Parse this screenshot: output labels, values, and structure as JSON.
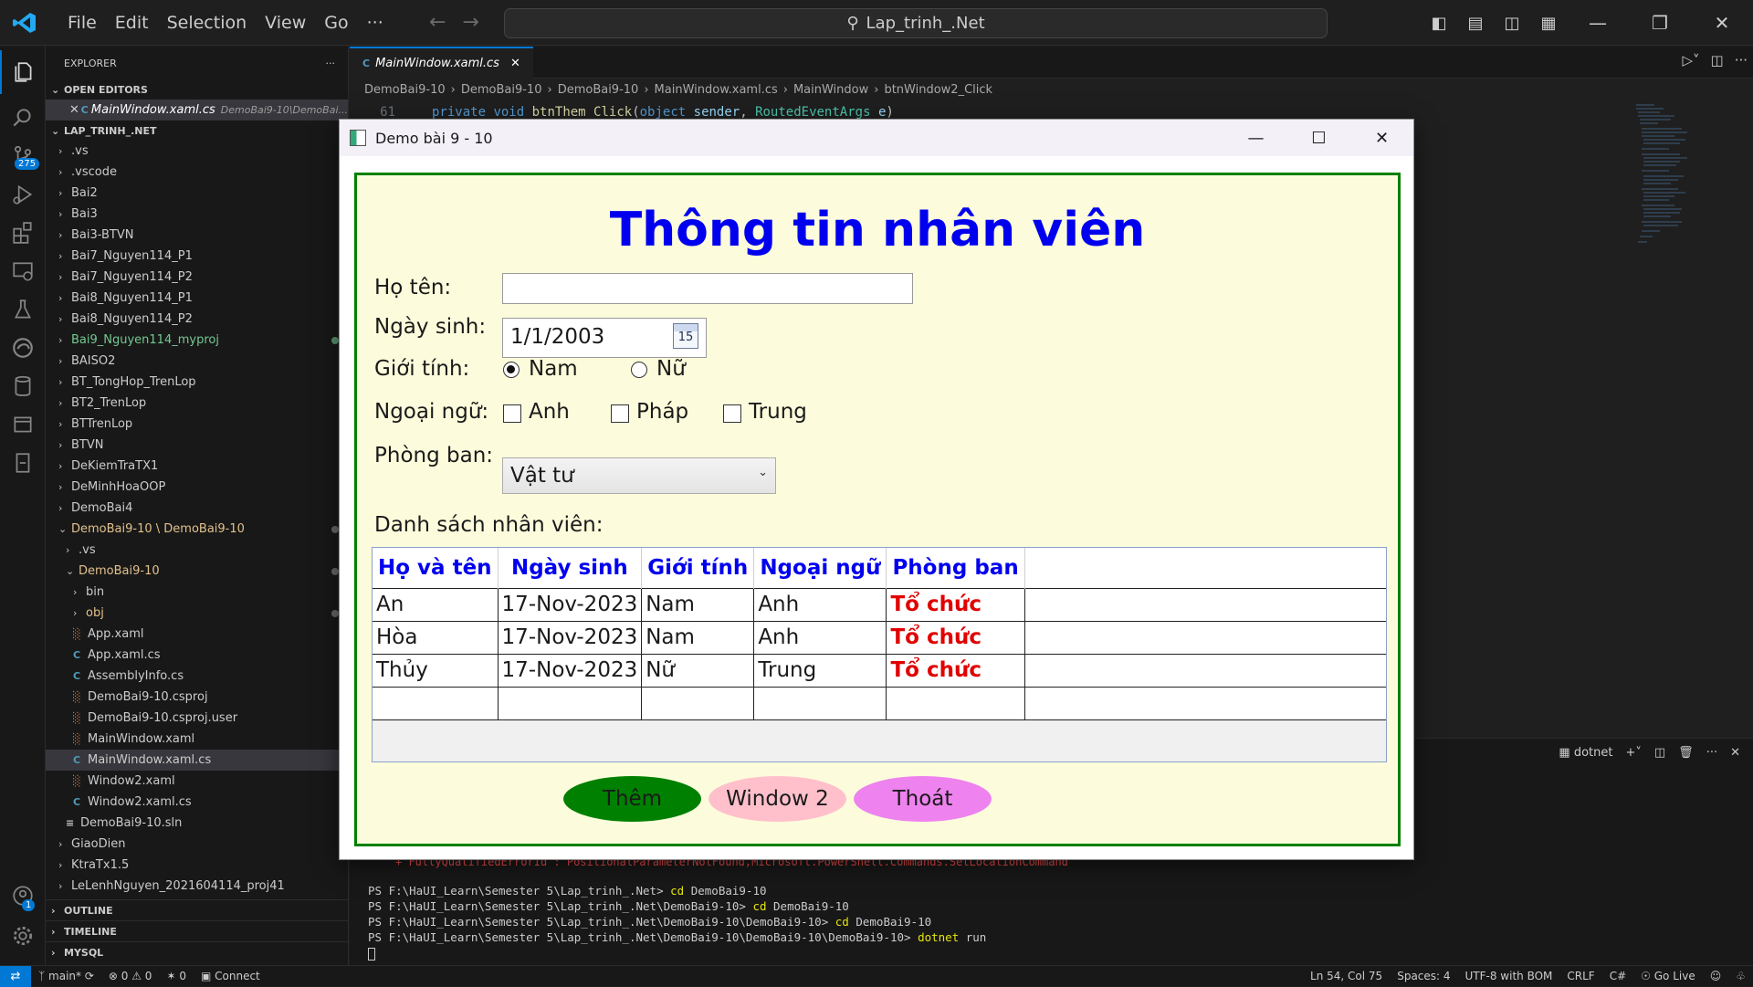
{
  "vscode": {
    "menu": [
      "File",
      "Edit",
      "Selection",
      "View",
      "Go",
      "···"
    ],
    "search_text": "Lap_trinh_.Net",
    "scm_badge": "275",
    "account_badge": "1",
    "explorer_title": "EXPLORER",
    "open_editors_label": "OPEN EDITORS",
    "open_editor_file": "MainWindow.xaml.cs",
    "open_editor_path": "DemoBai9-10\\DemoBai...",
    "root_label": "LAP_TRINH_.NET",
    "tree": [
      {
        "label": ".vs",
        "kind": "folder",
        "depth": 1
      },
      {
        "label": ".vscode",
        "kind": "folder",
        "depth": 1
      },
      {
        "label": "Bai2",
        "kind": "folder",
        "depth": 1
      },
      {
        "label": "Bai3",
        "kind": "folder",
        "depth": 1
      },
      {
        "label": "Bai3-BTVN",
        "kind": "folder",
        "depth": 1
      },
      {
        "label": "Bai7_Nguyen114_P1",
        "kind": "folder",
        "depth": 1
      },
      {
        "label": "Bai7_Nguyen114_P2",
        "kind": "folder",
        "depth": 1
      },
      {
        "label": "Bai8_Nguyen114_P1",
        "kind": "folder",
        "depth": 1
      },
      {
        "label": "Bai8_Nguyen114_P2",
        "kind": "folder",
        "depth": 1
      },
      {
        "label": "Bai9_Nguyen114_myproj",
        "kind": "folder",
        "depth": 1,
        "color": "green",
        "dot": "green"
      },
      {
        "label": "BAISO2",
        "kind": "folder",
        "depth": 1
      },
      {
        "label": "BT_TongHop_TrenLop",
        "kind": "folder",
        "depth": 1
      },
      {
        "label": "BT2_TrenLop",
        "kind": "folder",
        "depth": 1
      },
      {
        "label": "BTTrenLop",
        "kind": "folder",
        "depth": 1
      },
      {
        "label": "BTVN",
        "kind": "folder",
        "depth": 1
      },
      {
        "label": "DeKiemTraTX1",
        "kind": "folder",
        "depth": 1
      },
      {
        "label": "DeMinhHoaOOP",
        "kind": "folder",
        "depth": 1
      },
      {
        "label": "DemoBai4",
        "kind": "folder",
        "depth": 1
      },
      {
        "label": "DemoBai9-10 \\ DemoBai9-10",
        "kind": "open",
        "depth": 1,
        "color": "yellow",
        "dot": "grey"
      },
      {
        "label": ".vs",
        "kind": "folder",
        "depth": 2
      },
      {
        "label": "DemoBai9-10",
        "kind": "open",
        "depth": 2,
        "color": "yellow",
        "dot": "grey"
      },
      {
        "label": "bin",
        "kind": "folder",
        "depth": 3
      },
      {
        "label": "obj",
        "kind": "folder",
        "depth": 3,
        "color": "yellow",
        "dot": "grey"
      },
      {
        "label": "App.xaml",
        "kind": "xaml",
        "depth": 3
      },
      {
        "label": "App.xaml.cs",
        "kind": "cs",
        "depth": 3
      },
      {
        "label": "AssemblyInfo.cs",
        "kind": "cs",
        "depth": 3
      },
      {
        "label": "DemoBai9-10.csproj",
        "kind": "xaml",
        "depth": 3
      },
      {
        "label": "DemoBai9-10.csproj.user",
        "kind": "xaml",
        "depth": 3
      },
      {
        "label": "MainWindow.xaml",
        "kind": "xaml",
        "depth": 3
      },
      {
        "label": "MainWindow.xaml.cs",
        "kind": "cs",
        "depth": 3,
        "selected": true
      },
      {
        "label": "Window2.xaml",
        "kind": "xaml",
        "depth": 3
      },
      {
        "label": "Window2.xaml.cs",
        "kind": "cs",
        "depth": 3
      },
      {
        "label": "DemoBai9-10.sln",
        "kind": "sln",
        "depth": 2
      },
      {
        "label": "GiaoDien",
        "kind": "folder",
        "depth": 1
      },
      {
        "label": "KtraTx1.5",
        "kind": "folder",
        "depth": 1
      },
      {
        "label": "LeLenhNguyen_2021604114_proj41",
        "kind": "folder",
        "depth": 1
      }
    ],
    "outline_label": "OUTLINE",
    "timeline_label": "TIMELINE",
    "mysql_label": "MYSQL",
    "tab_label": "MainWindow.xaml.cs",
    "breadcrumb": [
      "DemoBai9-10",
      "DemoBai9-10",
      "DemoBai9-10",
      "MainWindow.xaml.cs",
      "MainWindow",
      "btnWindow2_Click"
    ],
    "code": {
      "line_no": "61",
      "kw1": "private",
      "kw2": "void",
      "fn": "btnThem_Click",
      "p1": "(",
      "kw3": "object",
      "arg1": "sender",
      "sep": ", ",
      "ty": "RoutedEventArgs",
      "arg2": "e",
      "p2": ")"
    },
    "terminal": {
      "tab": "dotnet",
      "error_line": "+ FullyQualifiedErrorId : PositionalParameterNotFound,Microsoft.PowerShell.Commands.SetLocationCommand",
      "lines": [
        {
          "prompt": "PS F:\\HaUI_Learn\\Semester 5\\Lap_trinh_.Net> ",
          "cmd": "cd",
          "arg": " DemoBai9-10"
        },
        {
          "prompt": "PS F:\\HaUI_Learn\\Semester 5\\Lap_trinh_.Net\\DemoBai9-10> ",
          "cmd": "cd",
          "arg": " DemoBai9-10"
        },
        {
          "prompt": "PS F:\\HaUI_Learn\\Semester 5\\Lap_trinh_.Net\\DemoBai9-10\\DemoBai9-10> ",
          "cmd": "cd",
          "arg": " DemoBai9-10"
        },
        {
          "prompt": "PS F:\\HaUI_Learn\\Semester 5\\Lap_trinh_.Net\\DemoBai9-10\\DemoBai9-10\\DemoBai9-10> ",
          "cmd": "dotnet",
          "arg": " run"
        }
      ]
    },
    "status": {
      "branch": "main*",
      "problems": "⊗ 0 ⚠ 0",
      "ports": "0",
      "connect": "Connect",
      "position": "Ln 54, Col 75",
      "spaces": "Spaces: 4",
      "encoding": "UTF-8 with BOM",
      "eol": "CRLF",
      "lang": "C#",
      "golive": "Go Live"
    }
  },
  "app": {
    "window_title": "Demo bài 9 - 10",
    "heading": "Thông tin nhân viên",
    "labels": {
      "name": "Họ tên:",
      "dob": "Ngày sinh:",
      "gender": "Giới tính:",
      "lang": "Ngoại ngữ:",
      "dept": "Phòng ban:",
      "list": "Danh sách nhân viên:"
    },
    "name_value": "",
    "dob_value": "1/1/2003",
    "calendar_glyph": "15",
    "gender_options": [
      "Nam",
      "Nữ"
    ],
    "gender_selected": "Nam",
    "languages": [
      "Anh",
      "Pháp",
      "Trung"
    ],
    "dept_selected": "Vật tư",
    "grid": {
      "columns": [
        "Họ và tên",
        "Ngày sinh",
        "Giới tính",
        "Ngoại ngữ",
        "Phòng ban"
      ],
      "rows": [
        [
          "An",
          "17-Nov-2023",
          "Nam",
          "Anh",
          "Tổ chức"
        ],
        [
          "Hòa",
          "17-Nov-2023",
          "Nam",
          "Anh",
          "Tổ chức"
        ],
        [
          "Thủy",
          "17-Nov-2023",
          "Nữ",
          "Trung",
          "Tổ chức"
        ],
        [
          "",
          "",
          "",
          "",
          ""
        ]
      ]
    },
    "buttons": [
      {
        "label": "Thêm",
        "color": "#008000"
      },
      {
        "label": "Window 2",
        "color": "#ffc0cb"
      },
      {
        "label": "Thoát",
        "color": "#ee82ee"
      }
    ],
    "colors": {
      "background": "#fcfcdc",
      "border": "#008000",
      "heading": "#0000ee",
      "dept_cell": "#e00000"
    }
  }
}
